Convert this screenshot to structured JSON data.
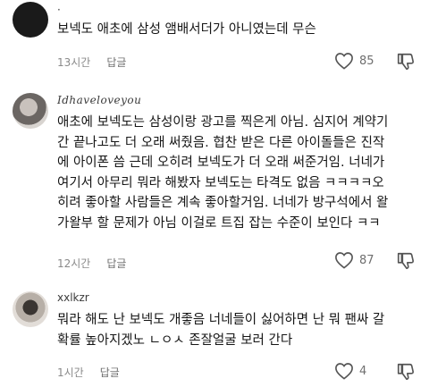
{
  "comments": [
    {
      "username": "·",
      "text": "보넥도 애초에 삼성 앰배서더가 아니였는데 무슨",
      "time": "13시간",
      "reply_label": "답글",
      "likes": "85"
    },
    {
      "username": "Idhaveloveyou",
      "text": "애초에 보넥도는 삼성이랑 광고를 찍은게 아님. 심지어 계약기\n간 끝나고도 더 오래 써줬음. 협찬 받은 다른 아이돌들은 진작\n에 아이폰 씀 근데 오히려 보넥도가 더 오래 써준거임. 너네가\n여기서 아무리 뭐라 해봤자 보넥도는 타격도 없음 ㅋㅋㅋㅋ오\n히려 좋아할 사람들은 계속 좋아할거임. 너네가 방구석에서 왈\n가왈부 할 문제가 아님 이걸로 트집 잡는 수준이 보인다 ㅋㅋ",
      "time": "12시간",
      "reply_label": "답글",
      "likes": "87"
    },
    {
      "username": "xxlkzr",
      "text": "뭐라 해도 난 보넥도 개좋음 너네들이 싫어하면 난 뭐 팬싸 갈\n확률 높아지겠노 ㄴㅇㅅ 존잘얼굴 보러 간다",
      "time": "1시간",
      "reply_label": "답글",
      "likes": "4"
    }
  ]
}
